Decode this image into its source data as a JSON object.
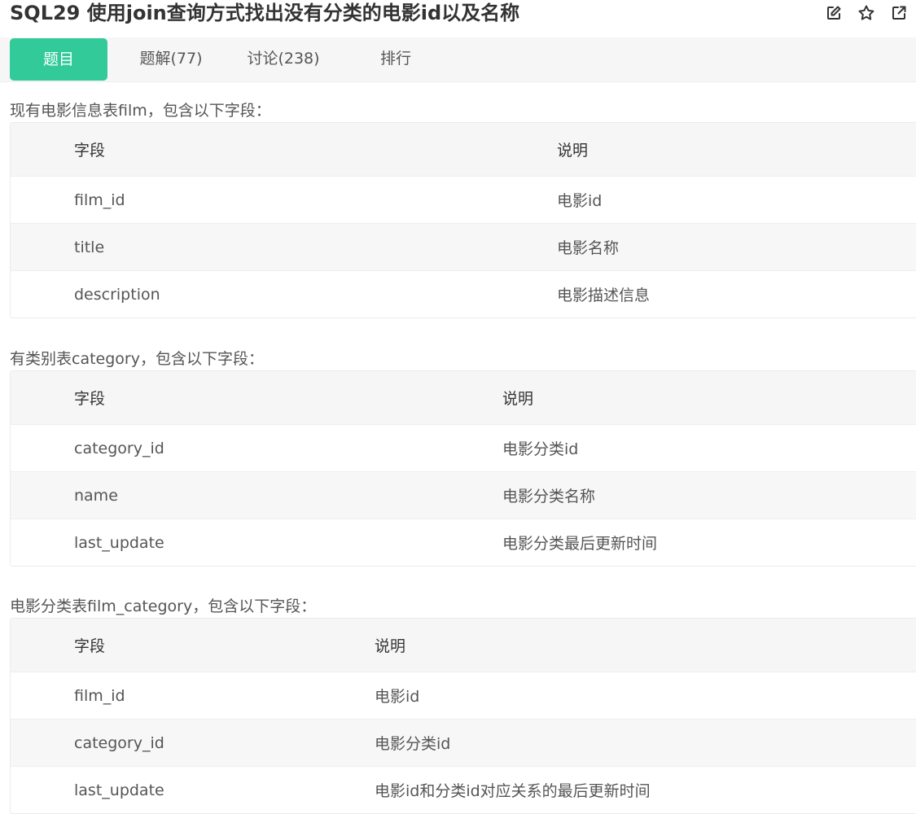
{
  "title": "SQL29  使用join查询方式找出没有分类的电影id以及名称",
  "title_icons": [
    "edit-icon",
    "star-icon",
    "external-link-icon"
  ],
  "tabs": [
    {
      "label": "题目",
      "active": true
    },
    {
      "label": "题解(77)",
      "active": false
    },
    {
      "label": "讨论(238)",
      "active": false
    },
    {
      "label": "排行",
      "active": false
    }
  ],
  "sections": [
    {
      "label": "现有电影信息表film，包含以下字段：",
      "headers": [
        "字段",
        "说明"
      ],
      "rows": [
        [
          "film_id",
          "电影id"
        ],
        [
          "title",
          "电影名称"
        ],
        [
          "description",
          "电影描述信息"
        ]
      ]
    },
    {
      "label": "有类别表category，包含以下字段：",
      "headers": [
        "字段",
        "说明"
      ],
      "rows": [
        [
          "category_id",
          "电影分类id"
        ],
        [
          "name",
          "电影分类名称"
        ],
        [
          "last_update",
          "电影分类最后更新时间"
        ]
      ]
    },
    {
      "label": "电影分类表film_category，包含以下字段：",
      "headers": [
        "字段",
        "说明"
      ],
      "rows": [
        [
          "film_id",
          "电影id"
        ],
        [
          "category_id",
          "电影分类id"
        ],
        [
          "last_update",
          "电影id和分类id对应关系的最后更新时间"
        ]
      ]
    }
  ],
  "colors": {
    "accent": "#32ca99",
    "text": "#555555",
    "title": "#333333"
  }
}
